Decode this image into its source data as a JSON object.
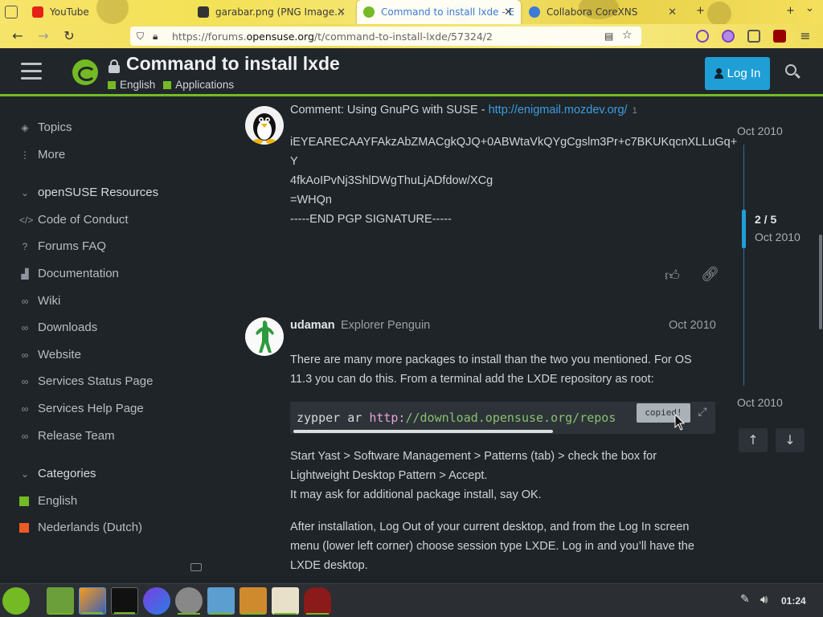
{
  "browser": {
    "tabs": [
      {
        "title": "YouTube",
        "active": false
      },
      {
        "title": "garabar.png (PNG Image...",
        "active": false
      },
      {
        "title": "Command to install lxde - E",
        "active": true
      },
      {
        "title": "Collabora CoreXNS",
        "active": false
      }
    ],
    "url_prefix": "https://forums.",
    "url_host": "opensuse.org",
    "url_path": "/t/command-to-install-lxde/57324/2",
    "new_tab_symbol": "+",
    "chevron_symbol": "⌄"
  },
  "header": {
    "title": "Command to install lxde",
    "categories": [
      "English",
      "Applications"
    ],
    "login_label": "Log In"
  },
  "sidebar": {
    "topics": "Topics",
    "more": "More",
    "resources_heading": "openSUSE Resources",
    "resources": [
      "Code of Conduct",
      "Forums FAQ",
      "Documentation",
      "Wiki",
      "Downloads",
      "Website",
      "Services Status Page",
      "Services Help Page",
      "Release Team"
    ],
    "categories_heading": "Categories",
    "categories": [
      {
        "name": "English",
        "color": "#73ba25"
      },
      {
        "name": "Nederlands (Dutch)",
        "color": "#f05a24"
      }
    ]
  },
  "post1": {
    "comment_prefix": "Comment: Using GnuPG with SUSE - ",
    "comment_link": "http://enigmail.mozdev.org/",
    "link_count": "1",
    "sig_line1": "iEYEARECAAYFAkzAbZMACgkQJQ+0ABWtaVkQYgCgslm3Pr+c7BKUKqcnXLLuGq+",
    "sig_line1b": "Y",
    "sig_line2": "4fkAoIPvNj3ShlDWgThuLjADfdow/XCg",
    "sig_line3": "=WHQn",
    "sig_line4": "-----END PGP SIGNATURE-----"
  },
  "post2": {
    "username": "udaman",
    "user_title": "Explorer Penguin",
    "date": "Oct 2010",
    "para1": "There are many more packages to install than the two you mentioned. For OS 11.3 you can do this. From a terminal add the LXDE repository as root:",
    "code_cmd": "zypper ar ",
    "code_url_a": "http:",
    "code_url_b": "//download.opensuse.org/repos",
    "copied_label": "copied!",
    "para2_line1": "Start Yast > Software Management > Patterns (tab) > check the box for Lightweight Desktop Pattern > Accept.",
    "para2_line2": "It may ask for additional package install, say OK.",
    "para3": "After installation, Log Out of your current desktop, and from the Log In screen menu (lower left corner) choose session type LXDE. Log in and you’ll have the LXDE desktop."
  },
  "timeline": {
    "top_date": "Oct 2010",
    "position": "2 / 5",
    "position_date": "Oct 2010",
    "bottom_date": "Oct 2010"
  },
  "taskbar": {
    "clock": "01:24"
  }
}
